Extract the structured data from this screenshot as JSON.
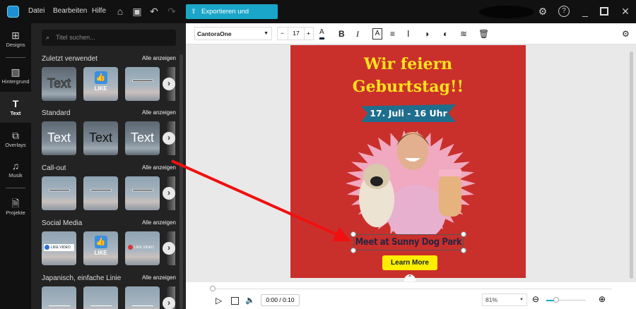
{
  "topbar": {
    "menu": [
      "Datei",
      "Bearbeiten",
      "Hilfe"
    ],
    "export_label": "Exportieren und Freigeben"
  },
  "rail": [
    {
      "label": "Designs",
      "icon": "layout-icon"
    },
    {
      "label": "Hintergrund",
      "icon": "background-icon"
    },
    {
      "label": "Text",
      "icon": "text-icon"
    },
    {
      "label": "Overlays",
      "icon": "overlays-icon"
    },
    {
      "label": "Musik",
      "icon": "music-icon"
    },
    {
      "label": "Projekte",
      "icon": "projects-icon"
    }
  ],
  "panel": {
    "search_placeholder": "Titel suchen...",
    "show_all": "Alle anzeigen",
    "sections": [
      {
        "title": "Zuletzt verwendet"
      },
      {
        "title": "Standard"
      },
      {
        "title": "Call-out"
      },
      {
        "title": "Social Media"
      },
      {
        "title": "Japanisch, einfache Linie"
      }
    ],
    "thumb_text": "Text",
    "like": "LIKE",
    "like_video": "LIKE VIDEO"
  },
  "toolbar": {
    "font": "CantoraOne",
    "size": "17",
    "minus": "−",
    "plus": "+"
  },
  "canvas": {
    "line1": "Wir feiern",
    "line2": "Geburtstag!!",
    "date": "17. Juli - 16 Uhr",
    "meet": "Meet at Sunny Dog Park",
    "button": "Learn More",
    "bg": "#c9302c",
    "accent": "#fde21c"
  },
  "playback": {
    "time": "0:00 / 0:10",
    "zoom": "81%"
  }
}
